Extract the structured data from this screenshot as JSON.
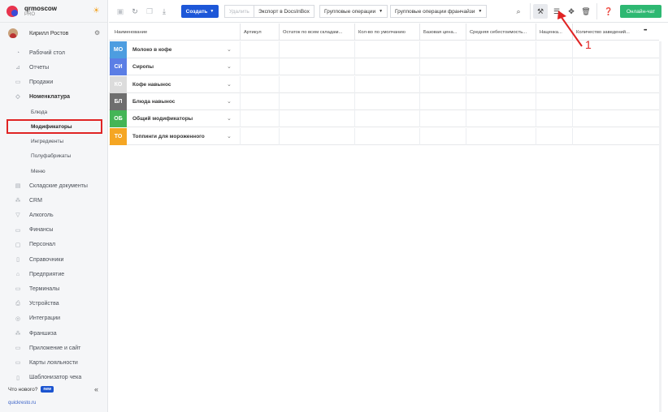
{
  "brand": {
    "name": "qrmoscow",
    "plan": "PRO"
  },
  "user": {
    "name": "Кирилл Ростов"
  },
  "sidebar": {
    "items": [
      {
        "label": "Рабочий стол",
        "icon": "dashboard-icon",
        "glyph": "◔"
      },
      {
        "label": "Отчеты",
        "icon": "reports-icon",
        "glyph": "⊿"
      },
      {
        "label": "Продажи",
        "icon": "sales-icon",
        "glyph": "▭"
      },
      {
        "label": "Номенклатура",
        "icon": "nomenclature-icon",
        "glyph": "◇"
      }
    ],
    "subitems": [
      {
        "label": "Блюда"
      },
      {
        "label": "Модификаторы"
      },
      {
        "label": "Ингредиенты"
      },
      {
        "label": "Полуфабрикаты"
      },
      {
        "label": "Меню"
      }
    ],
    "items2": [
      {
        "label": "Складские документы",
        "icon": "warehouse-icon",
        "glyph": "▤"
      },
      {
        "label": "CRM",
        "icon": "crm-icon",
        "glyph": "⁂"
      },
      {
        "label": "Алкоголь",
        "icon": "alcohol-icon",
        "glyph": "▽"
      },
      {
        "label": "Финансы",
        "icon": "finance-icon",
        "glyph": "▭"
      },
      {
        "label": "Персонал",
        "icon": "staff-icon",
        "glyph": "▢"
      },
      {
        "label": "Справочники",
        "icon": "directories-icon",
        "glyph": "▯"
      },
      {
        "label": "Предприятие",
        "icon": "enterprise-icon",
        "glyph": "⌂"
      },
      {
        "label": "Терминалы",
        "icon": "terminals-icon",
        "glyph": "▭"
      },
      {
        "label": "Устройства",
        "icon": "devices-icon",
        "glyph": "⎙"
      },
      {
        "label": "Интеграции",
        "icon": "integrations-icon",
        "glyph": "◎"
      },
      {
        "label": "Франшиза",
        "icon": "franchise-icon",
        "glyph": "⁂"
      },
      {
        "label": "Приложение и сайт",
        "icon": "app-site-icon",
        "glyph": "▭"
      },
      {
        "label": "Карты лояльности",
        "icon": "loyalty-icon",
        "glyph": "▭"
      },
      {
        "label": "Шаблонизатор чека",
        "icon": "receipt-template-icon",
        "glyph": "▯"
      }
    ],
    "whatsnew": "Что нового?",
    "whatsnew_badge": "new",
    "footer_link": "quickresto.ru"
  },
  "toolbar": {
    "create": "Создать",
    "delete": "Удалить",
    "export": "Экспорт в DocsInBox",
    "group_ops": "Групповые операции",
    "group_ops_franchise": "Групповые операции франчайзи",
    "chat": "Онлайн-чат"
  },
  "table": {
    "headers": [
      "Наименование",
      "Артикул",
      "Остаток по всем складам...",
      "Кол-во по умолчанию",
      "Базовая цена...",
      "Средняя себестоимость...",
      "Наценка...",
      "Количество заведений..."
    ],
    "rows": [
      {
        "abbr": "МО",
        "name": "Молоко в кофе",
        "color": "#4d9de0"
      },
      {
        "abbr": "СИ",
        "name": "Сиропы",
        "color": "#5b7ee5"
      },
      {
        "abbr": "КО",
        "name": "Кофе навынос",
        "color": "#dcdcdc"
      },
      {
        "abbr": "БЛ",
        "name": "Блюда навынос",
        "color": "#6e6e6e"
      },
      {
        "abbr": "ОБ",
        "name": "Общий модификаторы",
        "color": "#44b556"
      },
      {
        "abbr": "ТО",
        "name": "Топпинги для мороженного",
        "color": "#f5a623"
      }
    ]
  },
  "annotation": {
    "number": "1"
  }
}
